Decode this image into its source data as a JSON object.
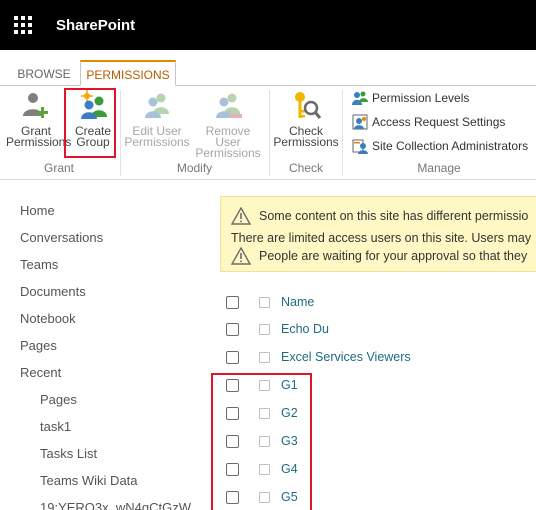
{
  "suite": {
    "app_name": "SharePoint",
    "menu_icon": "waffle-icon"
  },
  "tabs": [
    {
      "label": "BROWSE",
      "selected": false
    },
    {
      "label": "PERMISSIONS",
      "selected": true
    }
  ],
  "ribbon": {
    "groups": [
      {
        "label": "Grant"
      },
      {
        "label": "Modify"
      },
      {
        "label": "Check"
      },
      {
        "label": "Manage"
      }
    ],
    "buttons": {
      "grant": {
        "line1": "Grant",
        "line2": "Permissions",
        "icon": "grant-permissions-icon"
      },
      "create_group": {
        "line1": "Create",
        "line2": "Group",
        "icon": "create-group-icon"
      },
      "edit_user": {
        "line1": "Edit User",
        "line2": "Permissions",
        "icon": "edit-user-permissions-icon",
        "disabled": true
      },
      "remove_user": {
        "line1": "Remove User",
        "line2": "Permissions",
        "icon": "remove-user-permissions-icon",
        "disabled": true
      },
      "check": {
        "line1": "Check",
        "line2": "Permissions",
        "icon": "check-permissions-icon"
      }
    },
    "manage_items": [
      {
        "label": "Permission Levels",
        "icon": "permission-levels-icon"
      },
      {
        "label": "Access Request Settings",
        "icon": "access-request-icon"
      },
      {
        "label": "Site Collection Administrators",
        "icon": "site-admins-icon"
      }
    ]
  },
  "left_nav": {
    "items": [
      {
        "label": "Home"
      },
      {
        "label": "Conversations"
      },
      {
        "label": "Teams"
      },
      {
        "label": "Documents"
      },
      {
        "label": "Notebook"
      },
      {
        "label": "Pages"
      },
      {
        "label": "Recent"
      }
    ],
    "recent": [
      {
        "label": "Pages"
      },
      {
        "label": "task1"
      },
      {
        "label": "Tasks List"
      },
      {
        "label": "Teams Wiki Data"
      },
      {
        "label": "19:YERO3x_wN4gCtGzW"
      }
    ]
  },
  "notices": [
    {
      "text": "Some content on this site has different permissio",
      "icon": "warning-icon"
    },
    {
      "text": "There are limited access users on this site. Users may",
      "icon": ""
    },
    {
      "text": "People are waiting for your approval so that they",
      "icon": "warning-icon"
    }
  ],
  "table": {
    "header": "Name",
    "rows": [
      {
        "name": "Echo Du"
      },
      {
        "name": "Excel Services Viewers"
      },
      {
        "name": "G1"
      },
      {
        "name": "G2"
      },
      {
        "name": "G3"
      },
      {
        "name": "G4"
      },
      {
        "name": "G5"
      }
    ]
  },
  "colors": {
    "suite_bar": "#000000",
    "tab_accent": "#e08a00",
    "highlight": "#e0142b",
    "link": "#1f6b82",
    "notice_bg": "#fff8c5"
  }
}
